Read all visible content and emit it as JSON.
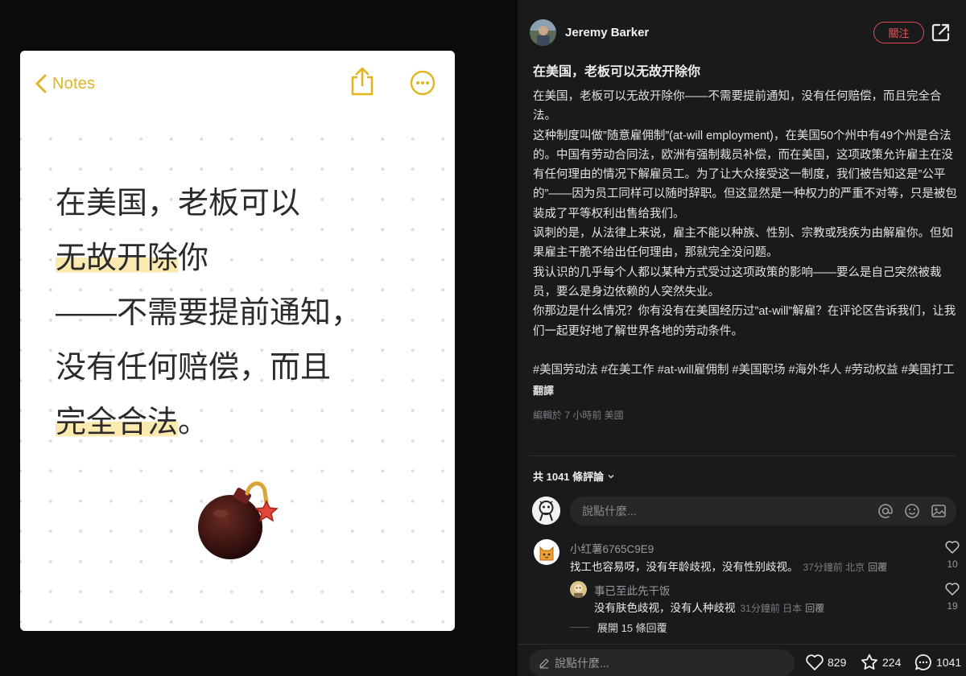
{
  "note": {
    "back_label": "Notes",
    "lines": [
      [
        {
          "text": "在美国，老板可以",
          "hl": false
        }
      ],
      [
        {
          "text": "无故开除",
          "hl": true
        },
        {
          "text": "你",
          "hl": false
        }
      ],
      [
        {
          "text": "——不需要提前通知，",
          "hl": false
        }
      ],
      [
        {
          "text": "没有任何赔偿，而且",
          "hl": false
        }
      ],
      [
        {
          "text": "完全合法",
          "hl": true
        },
        {
          "text": "。",
          "hl": false
        }
      ]
    ],
    "sticker": "bomb-icon",
    "highlight_color": "#fbeab0",
    "accent_color": "#e0b520"
  },
  "post": {
    "author": "Jeremy Barker",
    "follow_label": "關注",
    "title": "在美国，老板可以无故开除你",
    "paragraphs": [
      "在美国，老板可以无故开除你——不需要提前通知，没有任何赔偿，而且完全合法。",
      "这种制度叫做”随意雇佣制”(at-will employment)，在美国50个州中有49个州是合法的。中国有劳动合同法，欧洲有强制裁员补偿，而在美国，这项政策允许雇主在没有任何理由的情况下解雇员工。为了让大众接受这一制度，我们被告知这是”公平的”——因为员工同样可以随时辞职。但这显然是一种权力的严重不对等，只是被包装成了平等权利出售给我们。",
      "讽刺的是，从法律上来说，雇主不能以种族、性别、宗教或残疾为由解雇你。但如果雇主干脆不给出任何理由，那就完全没问题。",
      "我认识的几乎每个人都以某种方式受过这项政策的影响——要么是自己突然被裁员，要么是身边依赖的人突然失业。",
      "你那边是什么情况？你有没有在美国经历过”at-will”解雇？在评论区告诉我们，让我们一起更好地了解世界各地的劳动条件。"
    ],
    "tags": [
      "#美国劳动法",
      "#在美工作",
      "#at-will雇佣制",
      "#美国职场",
      "#海外华人",
      "#劳动权益",
      "#美国打工"
    ],
    "translate_label": "翻譯",
    "meta": "編輯於 7 小時前 美國"
  },
  "comments": {
    "count_label": "共 1041 條評論",
    "input_placeholder": "說點什麼...",
    "items": [
      {
        "user": "小红薯6765C9E9",
        "text": "找工也容易呀，没有年龄歧视，没有性别歧视。",
        "meta": "37分鐘前 北京",
        "reply_label": "回覆",
        "likes": "10"
      },
      {
        "user": "事已至此先干饭",
        "text": "没有肤色歧视，没有人种歧视",
        "meta": "31分鐘前 日本",
        "reply_label": "回覆",
        "likes": "19"
      }
    ],
    "expand_label": "展開 15 條回覆"
  },
  "bottom_bar": {
    "input_placeholder": "說點什麼...",
    "likes": "829",
    "stars": "224",
    "comments": "1041"
  },
  "colors": {
    "follow_red": "#e24a52",
    "dark_bg": "#191a1c"
  }
}
